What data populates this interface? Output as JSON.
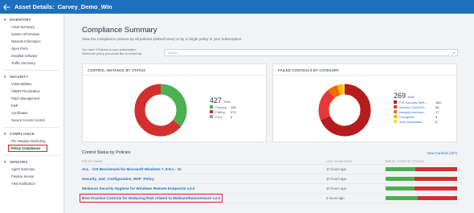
{
  "header": {
    "title_label": "Asset Details:",
    "title_value": "Carvey_Demo_Win"
  },
  "sidebar": {
    "sections": [
      {
        "title": "INVENTORY",
        "items": [
          "Asset Summary",
          "System Information",
          "Network Information",
          "Open Ports",
          "Installed Software",
          "Traffic Summary"
        ]
      },
      {
        "title": "SECURITY",
        "items": [
          "Vulnerabilities",
          "VMDR Prioritization",
          "Patch Management",
          "EDR",
          "Certificates",
          "Secure Access Control"
        ]
      },
      {
        "title": "COMPLIANCE",
        "items": [
          "File Integrity Monitoring",
          "Policy Compliance"
        ]
      },
      {
        "title": "SENSORS",
        "items": [
          "Agent Summary",
          "Passive Sensor",
          "Alert Notification"
        ]
      }
    ],
    "active_item": "Policy Compliance"
  },
  "main": {
    "title": "Compliance Summary",
    "subtitle": "View the compliance posture by all policies (default view) or by a single policy in your subscription.",
    "policy_text_1": "You have 4 Policies in your subscription.",
    "policy_text_2": "Select the policy you would like to review by:",
    "select_placeholder": "Select"
  },
  "colors": {
    "pass": "#4caf50",
    "fail": "#d32f2f",
    "error": "#9e9e9e",
    "accent": "#1f6fbf",
    "highlight": "#e02323"
  },
  "control_card": {
    "title": "CONTROL INSTANCE BY STATUS",
    "total_value": "427",
    "total_label": "Total",
    "legend": [
      {
        "name": "Passing",
        "value": "153",
        "color": "#4caf50"
      },
      {
        "name": "Failing",
        "value": "274",
        "color": "#d32f2f"
      },
      {
        "name": "Error",
        "value": "0",
        "color": "#9e9e9e"
      }
    ]
  },
  "failed_card": {
    "title": "FAILED CONTROLS BY CATEGORY",
    "total_value": "269",
    "total_label": "Total",
    "legend": [
      {
        "name": "CIS Security Setti...",
        "value": "184",
        "color": "#b71c1c"
      },
      {
        "name": "Access Control R...",
        "value": "54",
        "color": "#e53935"
      },
      {
        "name": "Integrity and Ava...",
        "value": "17",
        "color": "#ef6c00"
      },
      {
        "name": "Encryption",
        "value": "8",
        "color": "#ffb300"
      },
      {
        "name": "Anti-Virus/Malw...",
        "value": "5",
        "color": "#ffd54f"
      }
    ]
  },
  "status": {
    "title": "Control Status by Policies",
    "view_link": "View Controls (427)",
    "col_name": "POLICY NAME",
    "col_date": "LAST SCAN DATE",
    "col_break": "BREAK DOWN BY STATUS",
    "rows": [
      {
        "name": "ALL - CIS Benchmark for Microsoft Windows 7, 8-8.1 - 10",
        "date": "10 hours ago",
        "pass": 0.42,
        "fail": 0.58
      },
      {
        "name": "Security_and_Configuration_RDP_Policy",
        "date": "10 hours ago",
        "pass": 0.4,
        "fail": 0.6
      },
      {
        "name": "Minimum Security Hygiene for Windows Remote Endpoints v.2.0",
        "date": "10 hours ago",
        "pass": 0.4,
        "fail": 0.6
      },
      {
        "name": "Best Practice Controls for Reducing Risk related to Malware/Ransomware v.2.0",
        "date": "3 hours ago",
        "pass": 0.45,
        "fail": 0.55
      }
    ]
  }
}
